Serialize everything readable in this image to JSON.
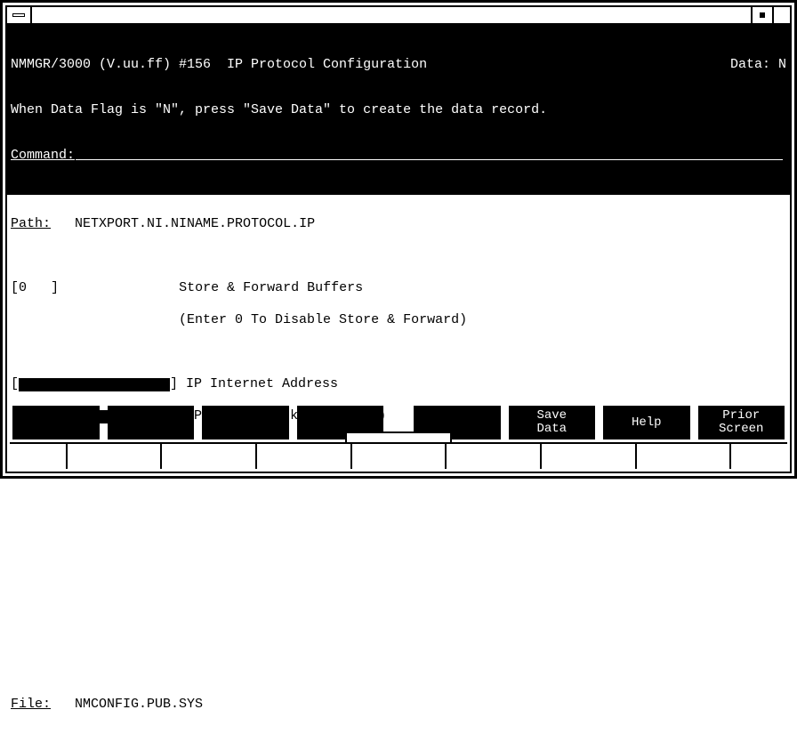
{
  "header": {
    "title_left": "NMMGR/3000 (V.uu.ff) #156  IP Protocol Configuration",
    "title_right": "Data: N",
    "hint": "When Data Flag is \"N\", press \"Save Data\" to create the data record.",
    "command_label": "Command:"
  },
  "path": {
    "label": "Path:",
    "value": "NETXPORT.NI.NINAME.PROTOCOL.IP"
  },
  "fields": {
    "buffers_value": "0",
    "buffers_label": "Store & Forward Buffers",
    "buffers_hint": "(Enter 0 To Disable Store & Forward)",
    "ip_addr_label": "IP Internet Address",
    "subnet_label": "IP Subnet Mask (Optional)"
  },
  "file": {
    "label": "File:",
    "value": "NMCONFIG.PUB.SYS"
  },
  "fkeys": {
    "f1": "",
    "f2": "",
    "f3": "",
    "f4": "",
    "f5": "",
    "f6": "Save\nData",
    "f7": "Help",
    "f8": "Prior\nScreen"
  }
}
